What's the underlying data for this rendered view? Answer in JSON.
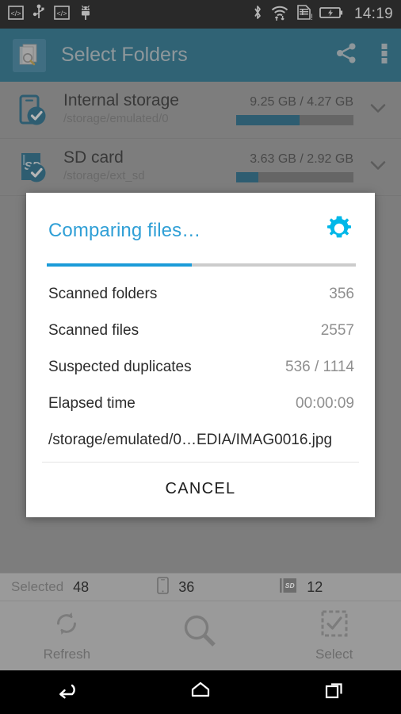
{
  "status_bar": {
    "time": "14:19",
    "left_icons": [
      "code-notification-icon",
      "usb-icon",
      "code-notification-icon",
      "android-debug-icon"
    ],
    "right_icons": [
      "bluetooth-icon",
      "wifi-icon",
      "sim-card-alert-icon",
      "battery-charging-icon"
    ]
  },
  "app_bar": {
    "title": "Select Folders",
    "app_icon": "documents-search-icon",
    "share_icon": "share-icon",
    "overflow_icon": "more-vert-icon",
    "background_color": "#0d6b8a"
  },
  "storage_list": [
    {
      "icon": "phone-checked-icon",
      "name": "Internal storage",
      "path": "/storage/emulated/0",
      "size": "9.25 GB / 4.27 GB",
      "used_percent": 54,
      "expand_icon": "chevron-down-icon"
    },
    {
      "icon": "sd-card-checked-icon",
      "name": "SD card",
      "path": "/storage/ext_sd",
      "size": "3.63 GB / 2.92 GB",
      "used_percent": 19,
      "expand_icon": "chevron-down-icon"
    }
  ],
  "dialog": {
    "title": "Comparing files…",
    "gear_icon": "settings-gear-icon",
    "gear_color": "#00b7e8",
    "progress_percent": 47,
    "progress_color": "#1b9bd8",
    "rows": [
      {
        "label": "Scanned folders",
        "value": "356"
      },
      {
        "label": "Scanned files",
        "value": "2557"
      },
      {
        "label": "Suspected duplicates",
        "value": "536 / 1114"
      },
      {
        "label": "Elapsed time",
        "value": "00:00:09"
      }
    ],
    "current_file": "/storage/emulated/0…EDIA/IMAG0016.jpg",
    "cancel_label": "CANCEL"
  },
  "selected_strip": {
    "label": "Selected",
    "total": "48",
    "phone_icon": "phone-icon",
    "phone_count": "36",
    "sd_icon": "sd-card-icon",
    "sd_count": "12"
  },
  "bottom_bar": {
    "items": [
      {
        "icon": "refresh-icon",
        "label": "Refresh"
      },
      {
        "icon": "search-icon",
        "label": ""
      },
      {
        "icon": "select-all-icon",
        "label": "Select"
      }
    ]
  },
  "nav_bar": {
    "back_icon": "back-icon",
    "home_icon": "home-icon",
    "recents_icon": "recents-icon"
  }
}
